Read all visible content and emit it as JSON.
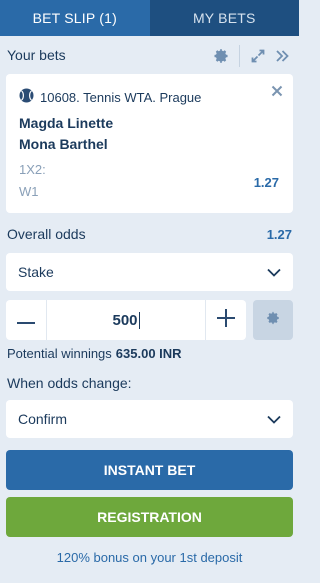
{
  "tabs": {
    "bet_slip": "BET SLIP (1)",
    "my_bets": "MY BETS"
  },
  "header": {
    "title": "Your bets",
    "icons": [
      "gear-icon",
      "expand-icon",
      "double-chevron-right-icon"
    ]
  },
  "bet": {
    "match": "10608. Tennis WTA. Prague",
    "team1": "Magda Linette",
    "team2": "Mona Barthel",
    "market": "1X2:",
    "outcome": "W1",
    "odd": "1.27"
  },
  "overall": {
    "label": "Overall odds",
    "value": "1.27"
  },
  "stake_select": {
    "label": "Stake"
  },
  "stake": {
    "value": "500"
  },
  "winnings": {
    "label": "Potential winnings",
    "amount": "635.00 INR"
  },
  "odds_change": {
    "label": "When odds change:",
    "selected": "Confirm"
  },
  "buttons": {
    "instant": "INSTANT BET",
    "registration": "REGISTRATION"
  },
  "bonus": "120% bonus on your 1st deposit",
  "colors": {
    "accent": "#2a6aa8",
    "tab_bg": "#1e4f80",
    "registration": "#6ea83c",
    "background": "#e5ecf4"
  }
}
